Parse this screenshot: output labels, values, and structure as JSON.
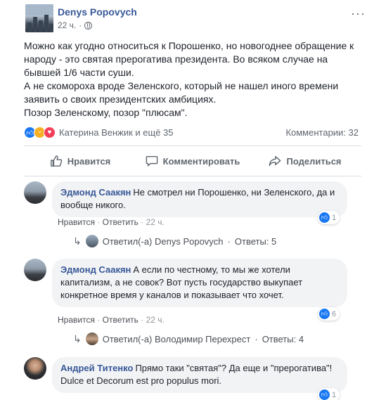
{
  "post": {
    "author": "Denys Popovych",
    "time": "22 ч.",
    "more": "···",
    "paragraphs": [
      "Можно как угодно относиться к Порошенко, но новогоднее обращение к народу - это святая прерогатива президента. Во всяком случае на бывшей 1/6 части суши.",
      "А не скомороха вроде Зеленского, который не нашел иного времени заявить о своих президентских амбициях.",
      "Позор Зеленскому, позор \"плюсам\"."
    ],
    "reactors": "Катерина Венжик и ещё 35",
    "comments_count": "Комментарии: 32"
  },
  "actions": {
    "like": "Нравится",
    "comment": "Комментировать",
    "share": "Поделиться"
  },
  "comments": [
    {
      "author": "Эдмонд Саакян",
      "text": "Не смотрел ни Порошенко, ни Зеленского, да и вообще никого.",
      "like": "Нравится",
      "reply": "Ответить",
      "time": "22 ч.",
      "reactions": "1",
      "replies_by": "Ответил(-а) Denys Popovych",
      "replies_count": "Ответы: 5"
    },
    {
      "author": "Эдмонд Саакян",
      "text": "А если по честному, то мы же хотели капитализм, а не совок? Вот пусть государство выкупает конкретное время у каналов и показывает что хочет.",
      "like": "Нравится",
      "reply": "Ответить",
      "time": "22 ч.",
      "reactions": "6",
      "replies_by": "Ответил(-а) Володимир Перехрест",
      "replies_count": "Ответы: 4"
    },
    {
      "author": "Андрей Титенко",
      "text": "Прямо таки \"святая\"? Да еще и \"прерогатива\"! Dulce et Decorum est pro populus mori.",
      "reactions": "1"
    }
  ],
  "colors": {
    "link": "#385898",
    "like_blue": "#1877f2",
    "muted": "#606770",
    "bubble": "#f2f3f5"
  }
}
